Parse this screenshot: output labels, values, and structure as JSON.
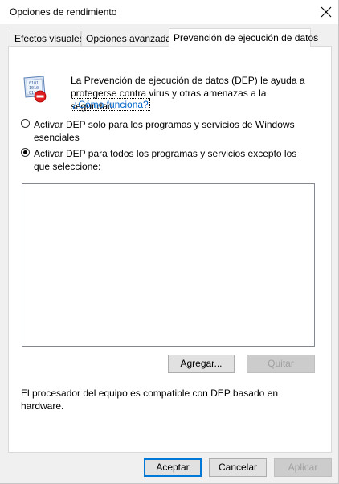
{
  "window": {
    "title": "Opciones de rendimiento"
  },
  "tabs": [
    {
      "label": "Efectos visuales",
      "active": false
    },
    {
      "label": "Opciones avanzadas",
      "active": false
    },
    {
      "label": "Prevención de ejecución de datos",
      "active": true
    }
  ],
  "dep": {
    "description": "La Prevención de ejecución de datos (DEP) le ayuda a protegerse contra virus y otras amenazas a la seguridad.",
    "link_label": "¿Cómo funciona?",
    "options": [
      {
        "label": "Activar DEP solo para los programas y servicios de Windows esenciales",
        "selected": false
      },
      {
        "label": "Activar DEP para todos los programas y servicios excepto los que seleccione:",
        "selected": true
      }
    ],
    "exceptions_list": [],
    "add_label": "Agregar...",
    "remove_label": "Quitar",
    "hardware_note": "El procesador del equipo es compatible con DEP basado en hardware."
  },
  "footer": {
    "ok_label": "Aceptar",
    "cancel_label": "Cancelar",
    "apply_label": "Aplicar"
  },
  "colors": {
    "link": "#0066cc",
    "default_button_border": "#0078d7"
  },
  "icons": {
    "close": "close-icon",
    "dep": "dep-shield-icon"
  }
}
